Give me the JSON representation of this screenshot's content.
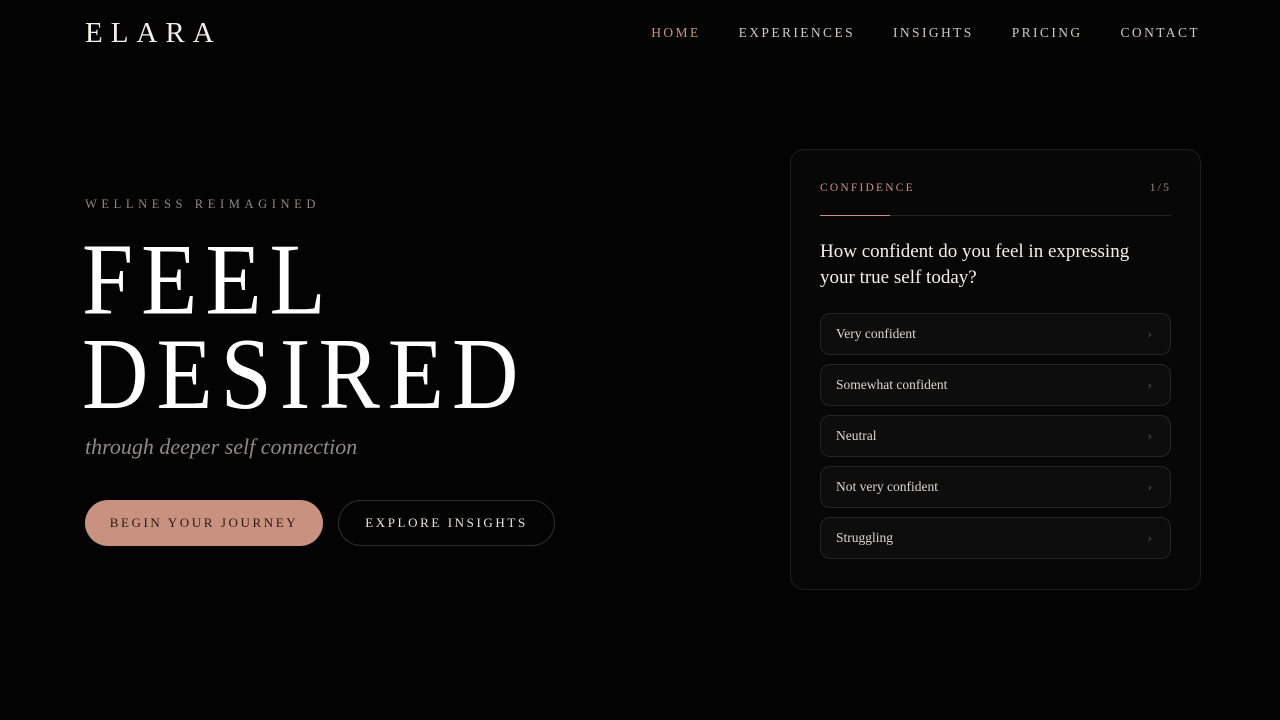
{
  "brand": {
    "logo": "ELARA"
  },
  "nav": {
    "items": [
      {
        "label": "HOME",
        "active": true
      },
      {
        "label": "EXPERIENCES",
        "active": false
      },
      {
        "label": "INSIGHTS",
        "active": false
      },
      {
        "label": "PRICING",
        "active": false
      },
      {
        "label": "CONTACT",
        "active": false
      }
    ]
  },
  "hero": {
    "eyebrow": "WELLNESS REIMAGINED",
    "headline_line1": "FEEL",
    "headline_line2": "DESIRED",
    "subline": "through deeper self connection",
    "primary_cta": "BEGIN YOUR JOURNEY",
    "secondary_cta": "EXPLORE INSIGHTS"
  },
  "quiz": {
    "category": "CONFIDENCE",
    "step": "1/5",
    "progress_fraction": 0.2,
    "question": "How confident do you feel in expressing your true self today?",
    "options": [
      "Very confident",
      "Somewhat confident",
      "Neutral",
      "Not very confident",
      "Struggling"
    ],
    "option_icon": "chevron-right-icon"
  },
  "colors": {
    "background": "#030303",
    "accent": "#c9917f",
    "text": "#f2eeea",
    "muted": "#8d8883"
  }
}
